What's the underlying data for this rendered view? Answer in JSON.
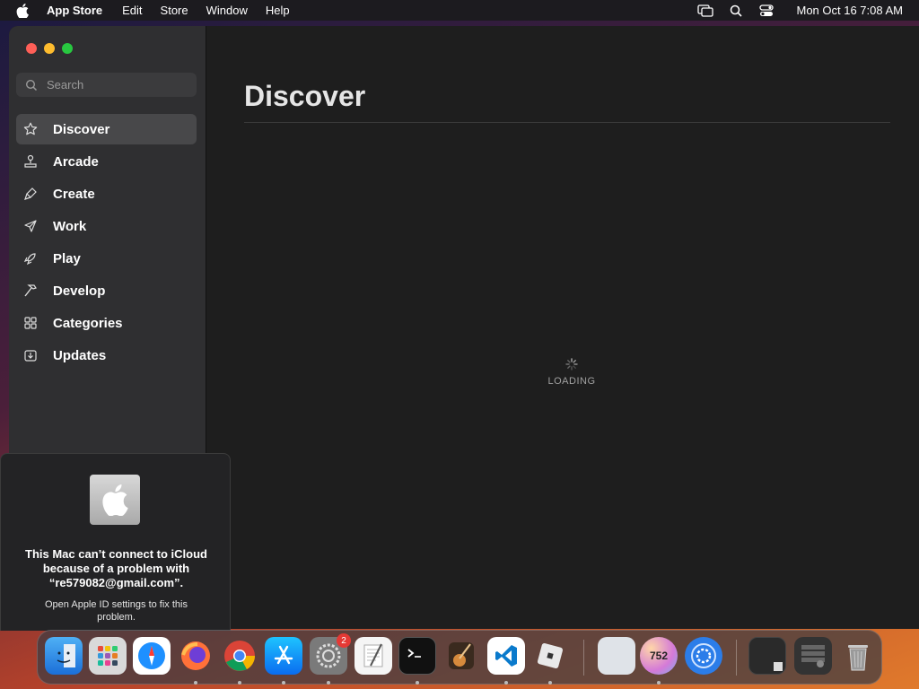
{
  "menubar": {
    "app_name": "App Store",
    "menus": [
      "Edit",
      "Store",
      "Window",
      "Help"
    ],
    "clock": "Mon Oct 16  7:08 AM"
  },
  "search": {
    "placeholder": "Search"
  },
  "sidebar": {
    "items": [
      {
        "label": "Discover",
        "icon": "star-icon"
      },
      {
        "label": "Arcade",
        "icon": "joystick-icon"
      },
      {
        "label": "Create",
        "icon": "brush-icon"
      },
      {
        "label": "Work",
        "icon": "paper-plane-icon"
      },
      {
        "label": "Play",
        "icon": "rocket-icon"
      },
      {
        "label": "Develop",
        "icon": "hammer-icon"
      },
      {
        "label": "Categories",
        "icon": "grid-icon"
      },
      {
        "label": "Updates",
        "icon": "download-icon"
      }
    ]
  },
  "main": {
    "title": "Discover",
    "loading_label": "LOADING"
  },
  "popup": {
    "message": "This Mac can’t connect to iCloud because of a problem with “re579082@gmail.com”.",
    "sub": "Open Apple ID settings to fix this problem."
  },
  "dock": {
    "settings_badge": "2",
    "calendar_badge": "752"
  },
  "colors": {
    "window_bg": "#1e1e1e",
    "sidebar_bg": "#2f2f31",
    "active_item": "#48484a"
  }
}
